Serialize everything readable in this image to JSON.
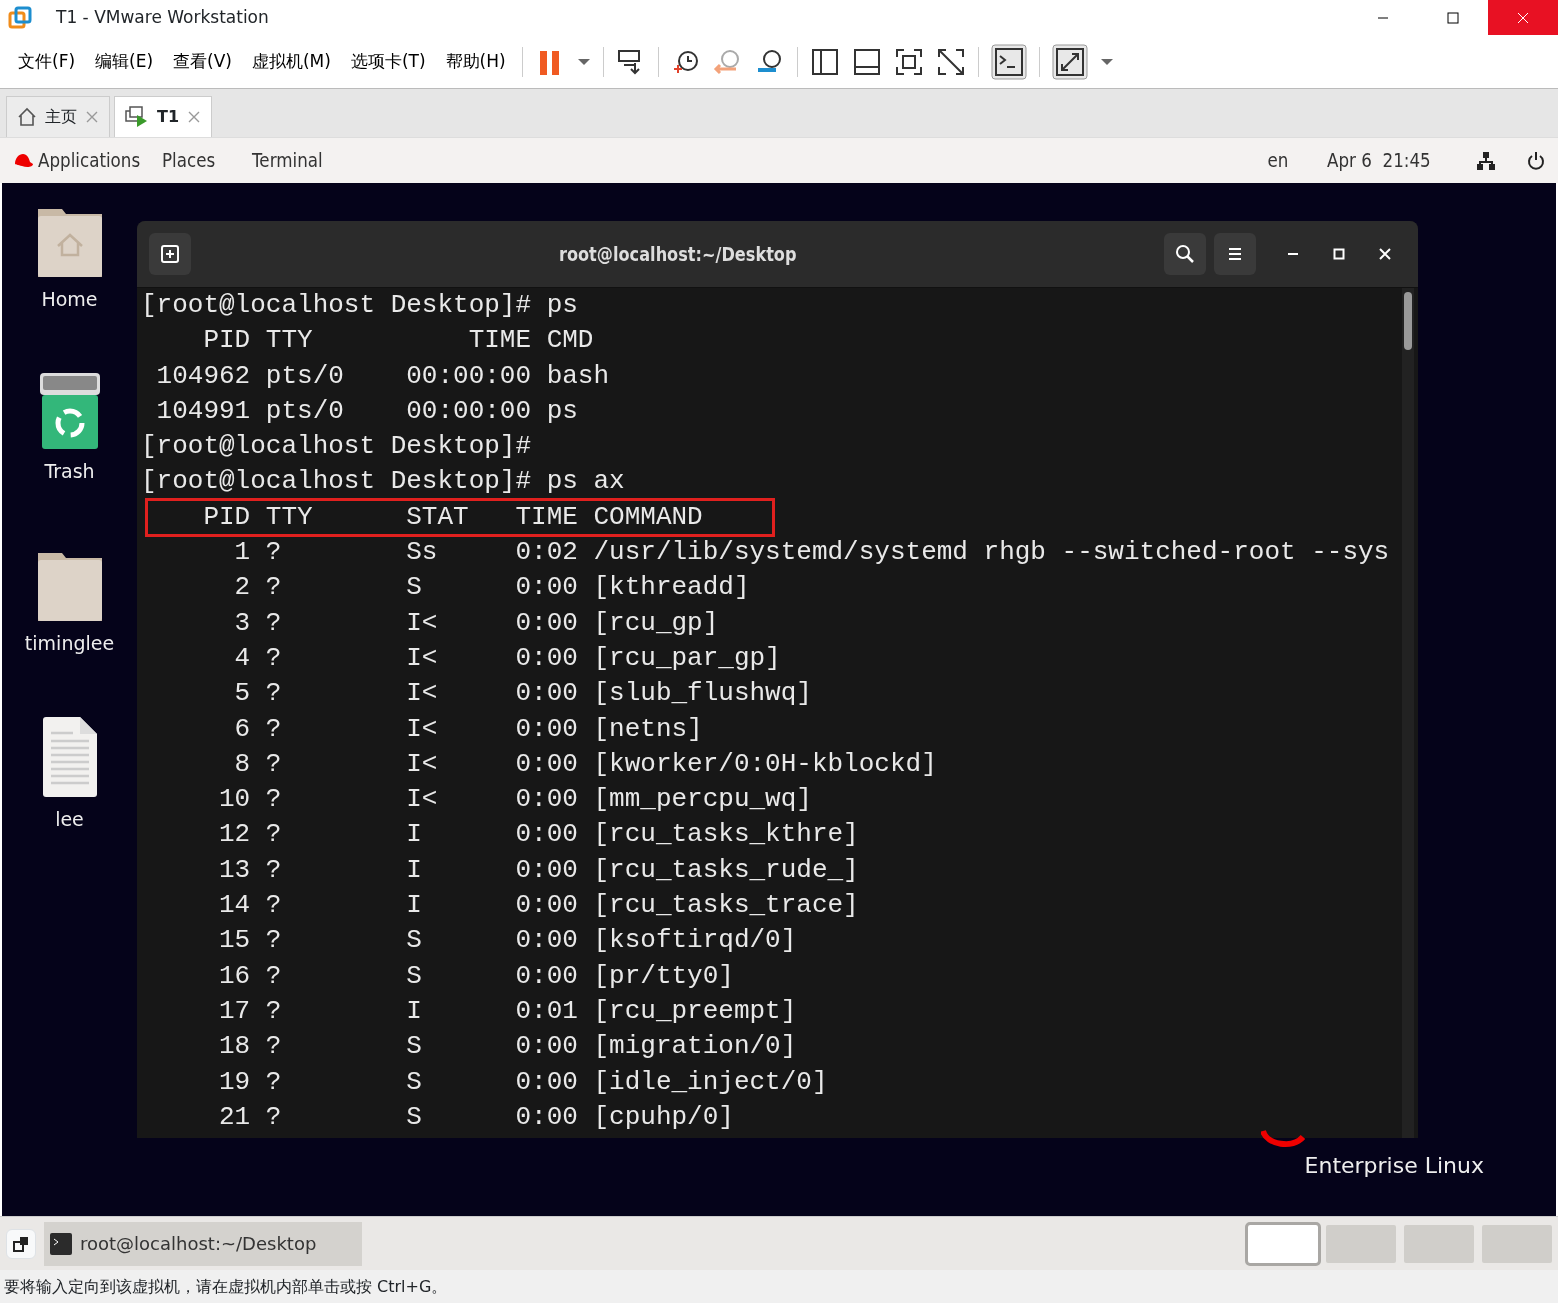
{
  "window": {
    "title": "T1 - VMware Workstation"
  },
  "menu": [
    "文件(F)",
    "编辑(E)",
    "查看(V)",
    "虚拟机(M)",
    "选项卡(T)",
    "帮助(H)"
  ],
  "tabs": [
    {
      "label": "主页",
      "kind": "home",
      "selected": false
    },
    {
      "label": "T1",
      "kind": "vm",
      "selected": true
    }
  ],
  "gnome_bar": {
    "menus": [
      "Applications",
      "Places",
      "Terminal"
    ],
    "language": "en",
    "clock": "Apr 6  21:45"
  },
  "desktop_icons": [
    {
      "label": "Home",
      "kind": "home-folder"
    },
    {
      "label": "Trash",
      "kind": "trash"
    },
    {
      "label": "timinglee",
      "kind": "folder"
    },
    {
      "label": "lee",
      "kind": "file"
    }
  ],
  "terminal": {
    "title": "root@localhost:~/Desktop",
    "lines": [
      {
        "text": "[root@localhost Desktop]# ps",
        "highlighted": false
      },
      {
        "text": "    PID TTY          TIME CMD",
        "highlighted": false
      },
      {
        "text": " 104962 pts/0    00:00:00 bash",
        "highlighted": false
      },
      {
        "text": " 104991 pts/0    00:00:00 ps",
        "highlighted": false
      },
      {
        "text": "[root@localhost Desktop]#",
        "highlighted": false
      },
      {
        "text": "[root@localhost Desktop]# ps ax",
        "highlighted": false
      },
      {
        "text": "    PID TTY      STAT   TIME COMMAND",
        "highlighted": true
      },
      {
        "text": "      1 ?        Ss     0:02 /usr/lib/systemd/systemd rhgb --switched-root --sys",
        "highlighted": false
      },
      {
        "text": "      2 ?        S      0:00 [kthreadd]",
        "highlighted": false
      },
      {
        "text": "      3 ?        I<     0:00 [rcu_gp]",
        "highlighted": false
      },
      {
        "text": "      4 ?        I<     0:00 [rcu_par_gp]",
        "highlighted": false
      },
      {
        "text": "      5 ?        I<     0:00 [slub_flushwq]",
        "highlighted": false
      },
      {
        "text": "      6 ?        I<     0:00 [netns]",
        "highlighted": false
      },
      {
        "text": "      8 ?        I<     0:00 [kworker/0:0H-kblockd]",
        "highlighted": false
      },
      {
        "text": "     10 ?        I<     0:00 [mm_percpu_wq]",
        "highlighted": false
      },
      {
        "text": "     12 ?        I      0:00 [rcu_tasks_kthre]",
        "highlighted": false
      },
      {
        "text": "     13 ?        I      0:00 [rcu_tasks_rude_]",
        "highlighted": false
      },
      {
        "text": "     14 ?        I      0:00 [rcu_tasks_trace]",
        "highlighted": false
      },
      {
        "text": "     15 ?        S      0:00 [ksoftirqd/0]",
        "highlighted": false
      },
      {
        "text": "     16 ?        S      0:00 [pr/tty0]",
        "highlighted": false
      },
      {
        "text": "     17 ?        I      0:01 [rcu_preempt]",
        "highlighted": false
      },
      {
        "text": "     18 ?        S      0:00 [migration/0]",
        "highlighted": false
      },
      {
        "text": "     19 ?        S      0:00 [idle_inject/0]",
        "highlighted": false
      },
      {
        "text": "     21 ?        S      0:00 [cpuhp/0]",
        "highlighted": false
      }
    ]
  },
  "branding": "Enterprise Linux",
  "taskbar": {
    "window_button": "root@localhost:~/Desktop",
    "workspaces": [
      {
        "selected": true
      },
      {
        "selected": false
      },
      {
        "selected": false
      },
      {
        "selected": false
      }
    ]
  },
  "status_bar": "要将输入定向到该虚拟机，请在虚拟机内部单击或按 Ctrl+G。"
}
